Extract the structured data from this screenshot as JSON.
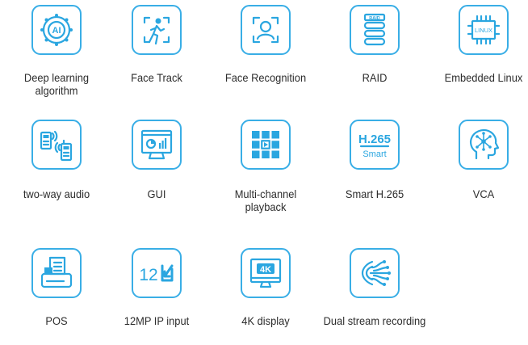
{
  "brand_color": "#39aee6",
  "features": [
    {
      "label": "Deep learning\nalgorithm",
      "icon": "ai-chip-icon"
    },
    {
      "label": "Face Track",
      "icon": "face-track-icon"
    },
    {
      "label": "Face Recognition",
      "icon": "face-recognition-icon"
    },
    {
      "label": "RAID",
      "icon": "raid-disks-icon"
    },
    {
      "label": "Embedded Linux",
      "icon": "linux-chip-icon"
    },
    {
      "label": "two-way audio",
      "icon": "walkie-talkie-icon"
    },
    {
      "label": "GUI",
      "icon": "gui-monitor-icon"
    },
    {
      "label": "Multi-channel playback",
      "icon": "multi-channel-playback-icon"
    },
    {
      "label": "Smart H.265",
      "icon": "h265-codec-icon"
    },
    {
      "label": "VCA",
      "icon": "vca-head-icon"
    },
    {
      "label": "POS",
      "icon": "pos-terminal-icon"
    },
    {
      "label": "12MP IP input",
      "icon": "12mp-input-icon"
    },
    {
      "label": "4K display",
      "icon": "4k-display-icon"
    },
    {
      "label": "Dual stream recording",
      "icon": "dual-stream-icon"
    }
  ],
  "icon_text": {
    "ai": "AI",
    "raid": "RAID",
    "linux": "LINUX",
    "h265_top": "H.265",
    "h265_bottom": "Smart",
    "mp_number": "12",
    "k4": "4K"
  }
}
